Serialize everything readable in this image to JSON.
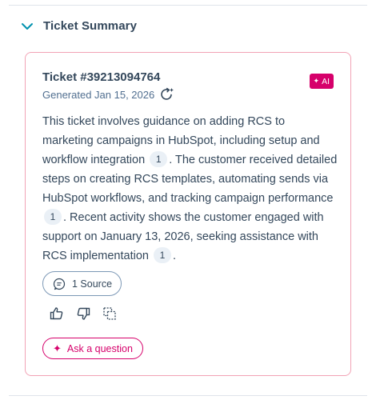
{
  "section": {
    "title": "Ticket Summary",
    "expanded": true,
    "chevron_icon": "chevron-down-icon",
    "accent_color": "#0091ae"
  },
  "card": {
    "ticket_title": "Ticket #39213094764",
    "ai_badge": "AI",
    "ai_badge_color": "#d6006b",
    "generated": "Generated Jan 15, 2026",
    "regenerate_icon": "regenerate-sparkle-icon",
    "summary": {
      "part1": "This ticket involves guidance on adding RCS to marketing campaigns in HubSpot, including setup and workflow integration",
      "part2": ". The customer received detailed steps on creating RCS templates, automating sends via HubSpot workflows, and tracking campaign performance",
      "part3": ". Recent activity shows the customer engaged with support on January 13, 2026, seeking assistance with RCS implementation",
      "part4": ".",
      "citations": [
        "1",
        "1",
        "1"
      ]
    },
    "sources_button": "1 Source",
    "feedback": {
      "thumbs_up_icon": "thumbs-up-icon",
      "thumbs_down_icon": "thumbs-down-icon",
      "copy_icon": "copy-icon"
    },
    "ask_button": "Ask a question",
    "border_color": "#f2a3b5"
  }
}
